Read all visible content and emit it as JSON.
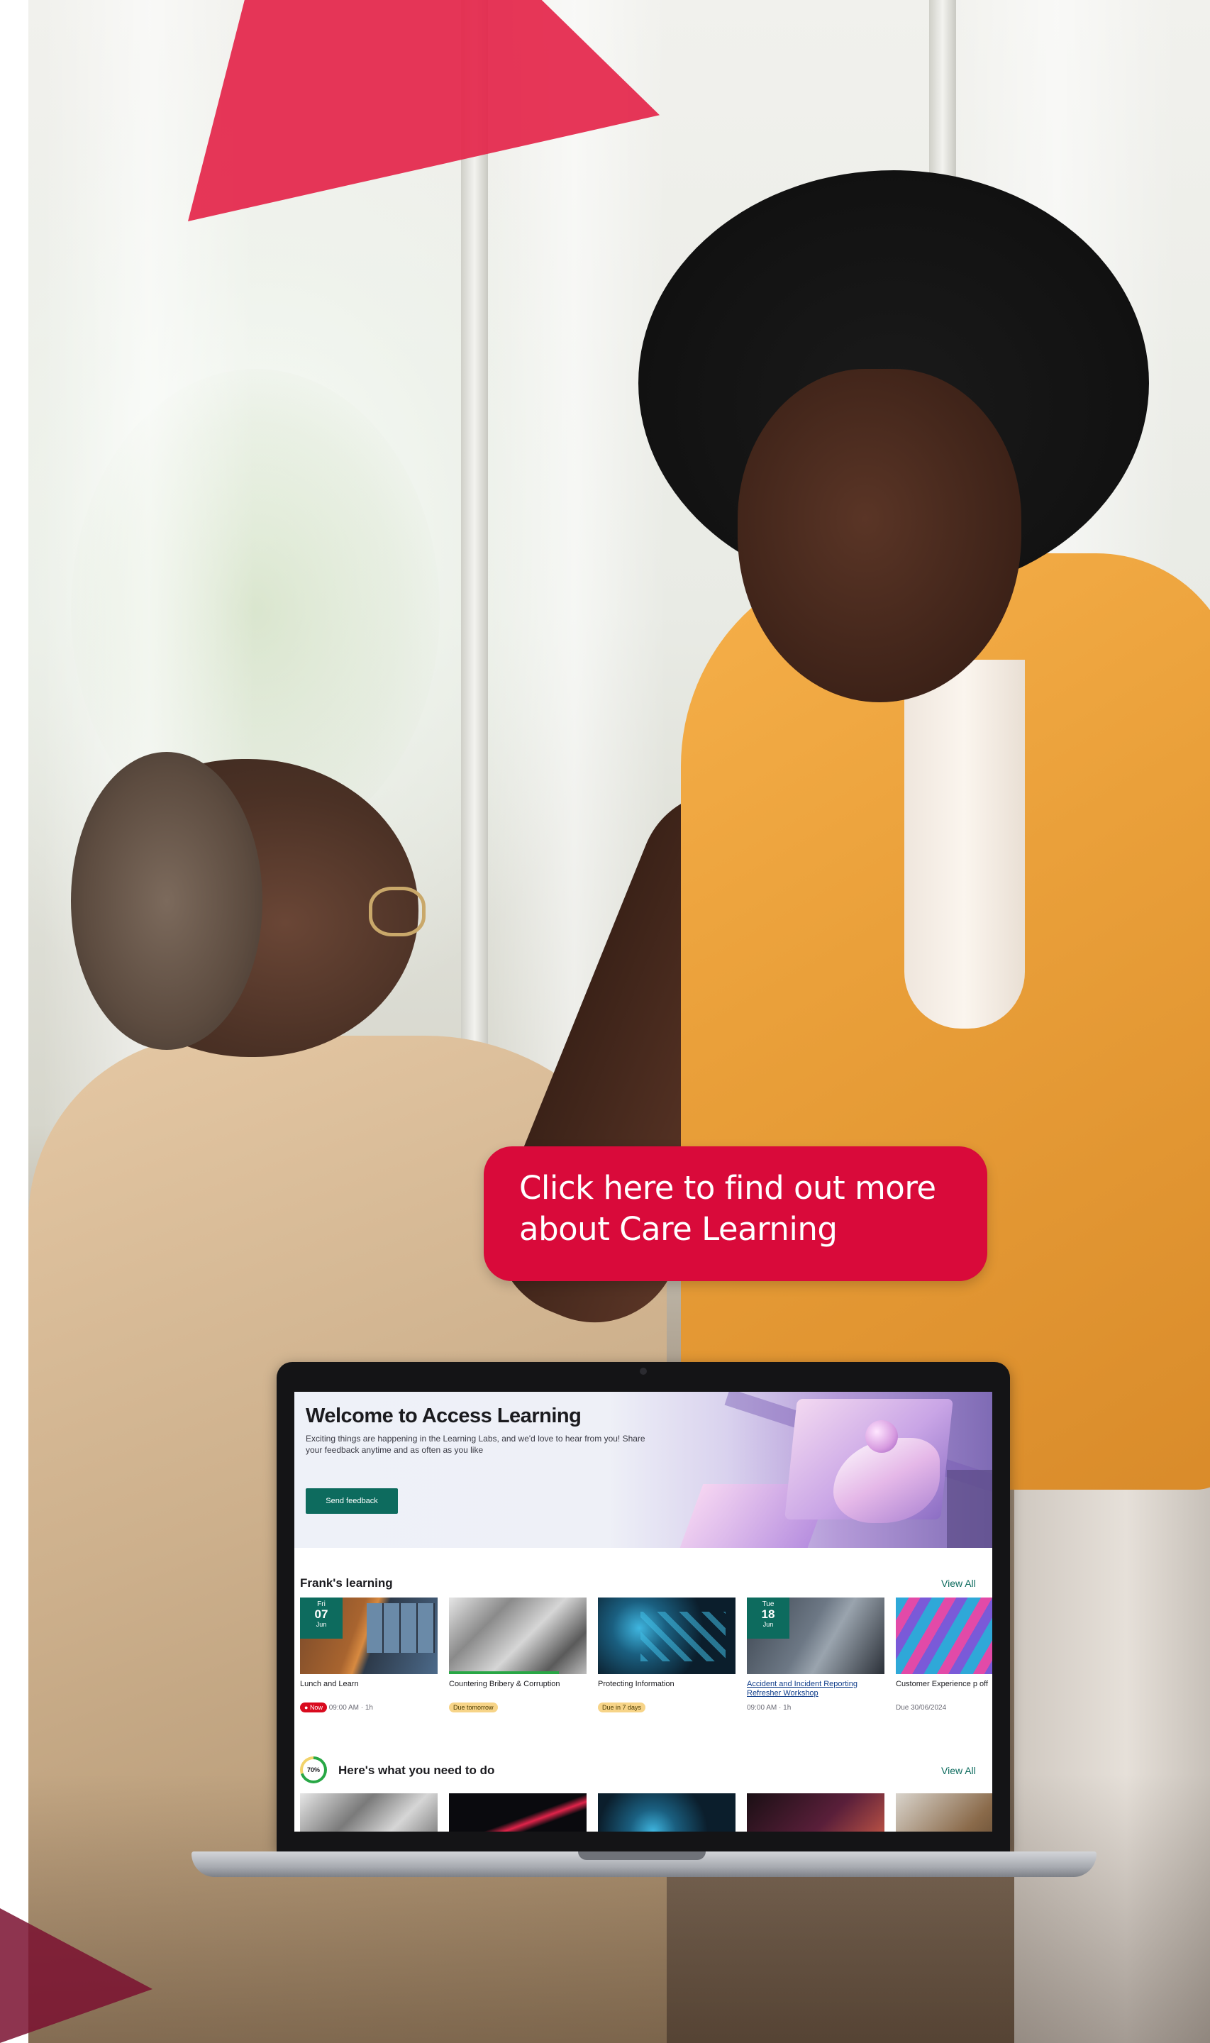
{
  "cta": {
    "line1": "Click here to find out more",
    "line2": "about Care Learning"
  },
  "hero": {
    "title": "Welcome to Access Learning",
    "subtitle": "Exciting things are happening in the Learning Labs, and we'd love to hear from you! Share your feedback anytime and as often as you like",
    "button_label": "Send feedback"
  },
  "franks_learning": {
    "title": "Frank's learning",
    "view_all": "View All",
    "cards": [
      {
        "title": "Lunch and Learn",
        "badge_day": "Fri",
        "badge_date": "07",
        "badge_month": "Jun",
        "status": "Now",
        "meta": "09:00 AM · 1h"
      },
      {
        "title": "Countering Bribery & Corruption",
        "status": "Due tomorrow",
        "progress": 0.8
      },
      {
        "title": "Protecting Information",
        "status": "Due in 7 days"
      },
      {
        "title": "Accident and Incident Reporting Refresher Workshop",
        "badge_day": "Tue",
        "badge_date": "18",
        "badge_month": "Jun",
        "meta": "09:00 AM · 1h"
      },
      {
        "title": "Customer Experience p off",
        "meta": "Due 30/06/2024"
      }
    ]
  },
  "todo": {
    "title": "Here's what you need to do",
    "view_all": "View All",
    "progress_label": "70%",
    "progress": 0.7
  },
  "colors": {
    "accent_red": "#d90a3a",
    "brand_teal": "#0d6b5e",
    "triangle_red": "#e4254a"
  }
}
